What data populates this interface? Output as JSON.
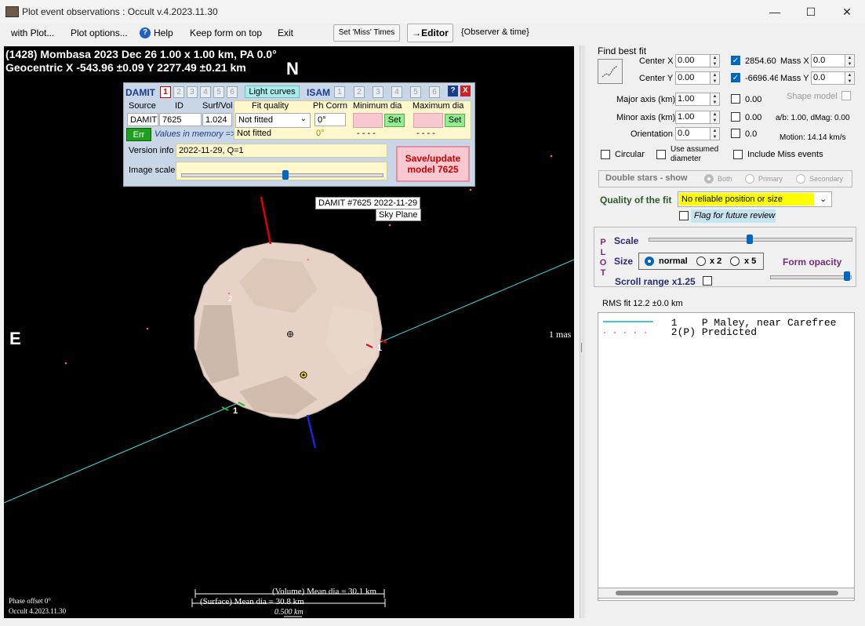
{
  "window": {
    "title": "Plot event observations : Occult v.4.2023.11.30",
    "minimize": "—",
    "maximize": "☐",
    "close": "✕"
  },
  "menu": {
    "with_plot": "with Plot...",
    "plot_options": "Plot options...",
    "help": "Help",
    "keep_form": "Keep form on top",
    "exit": "Exit",
    "set_miss": "Set 'Miss' Times",
    "editor": "→Editor",
    "observer_time": "{Observer & time}"
  },
  "plot": {
    "header1": "(1428) Mombasa  2023 Dec 26   1.00 x 1.00 km,  PA 0.0°",
    "header2": "Geocentric  X  -543.96 ±0.09  Y 2277.49 ±0.21 km",
    "north": "N",
    "east": "E",
    "scale_mas": "1 mas",
    "model_label1": "DAMIT #7625 2022-11-29",
    "model_label2": "Sky Plane",
    "chord_label_right": "1",
    "chord_label_left": "1",
    "point_label": "2",
    "phase_offset": "Phase offset 0°",
    "version": "Occult 4.2023.11.30",
    "volume_dia": "(Volume) Mean dia = 30.1 km",
    "surface_dia": "(Surface) Mean dia = 30.8 km",
    "scale_bar": "0.500 km"
  },
  "damit_panel": {
    "damit_label": "DAMIT",
    "damit_tabs": [
      "1",
      "2",
      "3",
      "4",
      "5",
      "6"
    ],
    "light_curves": "Light curves",
    "isam_label": "ISAM",
    "isam_tabs": [
      "1",
      "2",
      "3",
      "4",
      "5",
      "6"
    ],
    "help_btn": "?",
    "close_btn": "X",
    "source_hdr": "Source",
    "id_hdr": "ID",
    "surfvol_hdr": "Surf/Vol",
    "source_val": "DAMIT",
    "id_val": "7625",
    "surfvol_val": "1.024",
    "err_btn": "Err",
    "values_memory": "Values in memory =>",
    "fit_quality_hdr": "Fit quality",
    "phcorr_hdr": "Ph Corrn",
    "min_dia_hdr": "Minimum dia",
    "max_dia_hdr": "Maximum dia",
    "fit_quality_val": "Not fitted",
    "fit_quality_mem": "Not fitted",
    "phcorr_val": "0°",
    "phcorr_mem": "0°",
    "min_dia_mem": "- - - -",
    "max_dia_mem": "- - - -",
    "set1": "Set",
    "set2": "Set",
    "version_info_lbl": "Version info",
    "version_info_val": "2022-11-29, Q=1",
    "image_scale_lbl": "Image scale",
    "save_btn": "Save/update model 7625"
  },
  "right": {
    "find_best_fit": "Find best fit",
    "center_x_lbl": "Center X",
    "center_x": "0.00",
    "center_y_lbl": "Center Y",
    "center_y": "0.00",
    "mass_x_val": "2854.60",
    "mass_x_lbl": "Mass X",
    "mass_x": "0.0",
    "mass_y_val": "-6696.46",
    "mass_y_lbl": "Mass Y",
    "mass_y": "0.0",
    "major_lbl": "Major axis (km)",
    "major": "1.00",
    "major_err": "0.00",
    "shape_model": "Shape model",
    "minor_lbl": "Minor axis (km)",
    "minor": "1.00",
    "minor_err": "0.00",
    "ab_dmag": "a/b: 1.00, dMag: 0.00",
    "orient_lbl": "Orientation",
    "orient": "0.0",
    "orient_err": "0.0",
    "motion": "Motion: 14.14 km/s",
    "circular": "Circular",
    "use_assumed": "Use assumed diameter",
    "include_miss": "Include Miss events",
    "double_stars": "Double stars - show",
    "both": "Both",
    "primary": "Primary",
    "secondary": "Secondary",
    "quality_lbl": "Quality of the fit",
    "quality_val": "No reliable position or size",
    "flag_review": "Flag for future review",
    "plot_letters": [
      "P",
      "L",
      "O",
      "T"
    ],
    "scale_lbl": "Scale",
    "size_lbl": "Size",
    "size_normal": "normal",
    "size_x2": "x 2",
    "size_x5": "x 5",
    "form_opacity": "Form opacity",
    "scroll_range": "Scroll range x1.25",
    "rms_fit": "RMS fit 12.2 ±0.0 km",
    "legend": [
      {
        "line": "      1    P Maley, near Carefree"
      },
      {
        "line": "      2(P) Predicted"
      }
    ]
  },
  "colors": {
    "plot_bg": "#000000",
    "chord_line": "#40e0e0",
    "north_axis": "#e00000",
    "south_axis": "#2020e0",
    "asteroid": "#e8d4c8",
    "accent": "#0067c0"
  }
}
